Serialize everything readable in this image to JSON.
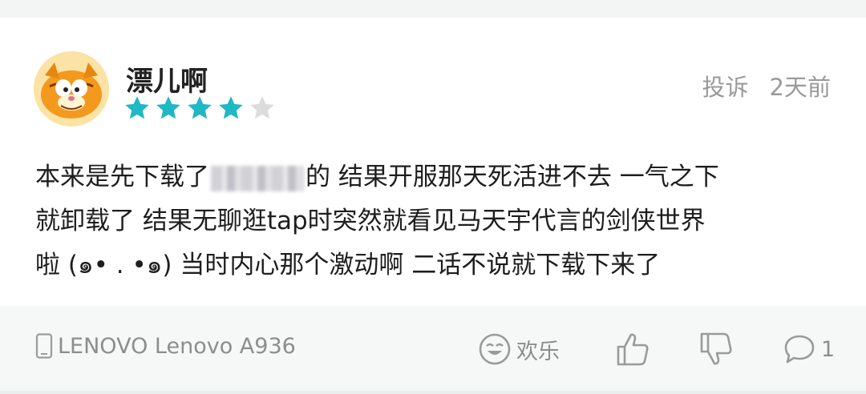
{
  "review": {
    "username": "漂儿啊",
    "rating": 4,
    "rating_max": 5,
    "report_label": "投诉",
    "time_ago": "2天前",
    "text_lines": [
      "本来是先下载了",
      "的 结果开服那天死活进不去 一气之下",
      "就卸载了 结果无聊逛tap时突然就看见马天宇代言的剑侠世界",
      "啦 (๑• . •๑) 当时内心那个激动啊 二话不说就下载下来了"
    ]
  },
  "footer": {
    "device_name": "LENOVO Lenovo A936",
    "funny_label": "欢乐",
    "reply_count": "1"
  },
  "colors": {
    "star_filled": "#1fb8c4",
    "star_empty": "#dcdcdc",
    "meta_text": "#9a9a9a",
    "body_text": "#1e1e1e",
    "footer_bg": "#f6f7f7"
  },
  "icons": {
    "avatar": "garfield-avatar",
    "device": "phone-icon",
    "funny": "smiley-icon",
    "like": "thumbs-up-icon",
    "dislike": "thumbs-down-icon",
    "reply": "comment-bubble-icon"
  }
}
